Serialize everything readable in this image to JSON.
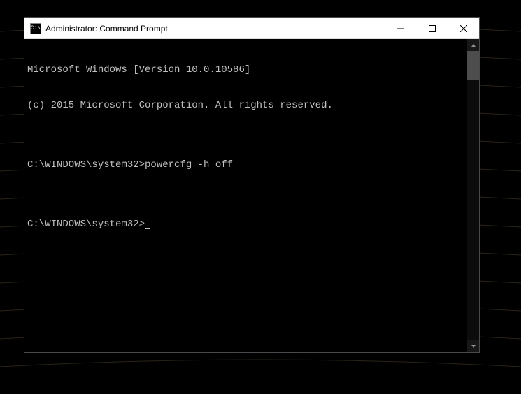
{
  "window": {
    "title": "Administrator: Command Prompt",
    "icon_label": "C:\\"
  },
  "terminal": {
    "lines": {
      "version": "Microsoft Windows [Version 10.0.10586]",
      "copyright": "(c) 2015 Microsoft Corporation. All rights reserved.",
      "blank1": "",
      "cmd1_prompt": "C:\\WINDOWS\\system32>",
      "cmd1_input": "powercfg -h off",
      "blank2": "",
      "cmd2_prompt": "C:\\WINDOWS\\system32>"
    }
  }
}
